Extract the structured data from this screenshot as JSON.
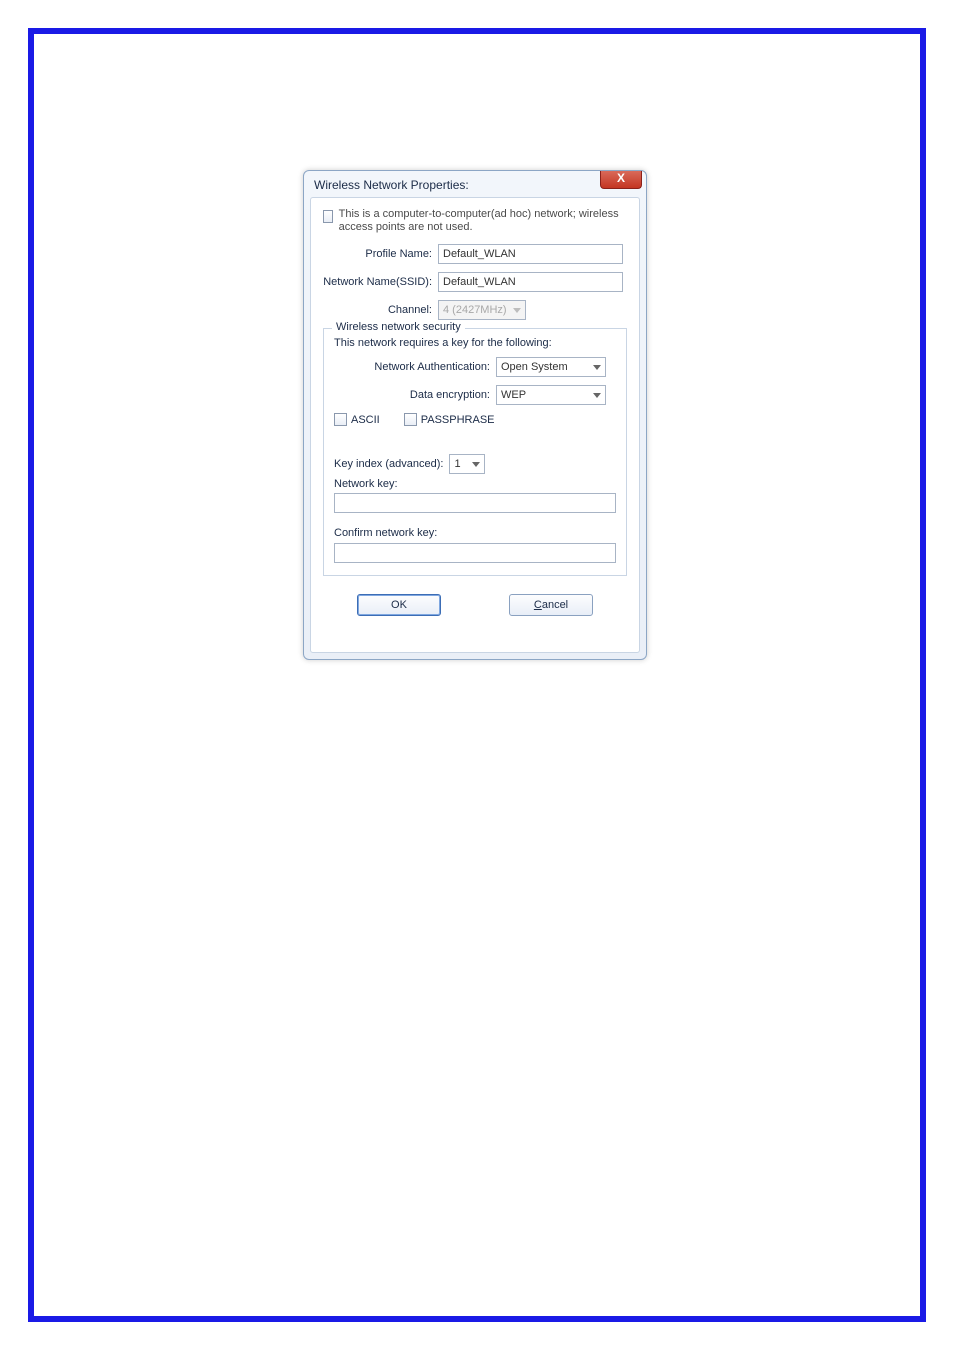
{
  "dialog": {
    "title": "Wireless Network Properties:",
    "close_label": "X"
  },
  "adhoc": {
    "text": "This is a computer-to-computer(ad hoc) network; wireless access points are not used."
  },
  "labels": {
    "profile_name": "Profile Name:",
    "ssid": "Network Name(SSID):",
    "channel": "Channel:"
  },
  "values": {
    "profile_name": "Default_WLAN",
    "ssid": "Default_WLAN",
    "channel": "4 (2427MHz)"
  },
  "security": {
    "legend": "Wireless network security",
    "requires_text": "This network requires a key for the following:",
    "auth_label": "Network Authentication:",
    "auth_value": "Open System",
    "encryption_label": "Data encryption:",
    "encryption_value": "WEP",
    "ascii_label": "ASCII",
    "passphrase_label": "PASSPHRASE",
    "key_index_label": "Key index (advanced):",
    "key_index_value": "1",
    "network_key_label": "Network key:",
    "network_key_value": "",
    "confirm_key_label": "Confirm network key:",
    "confirm_key_value": ""
  },
  "buttons": {
    "ok": "OK",
    "cancel_prefix": "C",
    "cancel_rest": "ancel"
  }
}
